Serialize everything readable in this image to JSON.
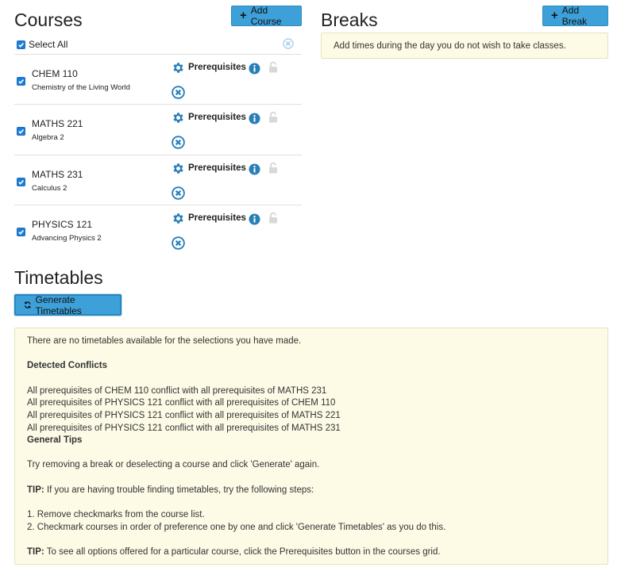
{
  "courses": {
    "title": "Courses",
    "add_label": "Add Course",
    "select_all_label": "Select All",
    "items": [
      {
        "code": "CHEM 110",
        "name": "Chemistry of the Living World",
        "prereq_label": "Prerequisites",
        "checked": true
      },
      {
        "code": "MATHS 221",
        "name": "Algebra 2",
        "prereq_label": "Prerequisites",
        "checked": true
      },
      {
        "code": "MATHS 231",
        "name": "Calculus 2",
        "prereq_label": "Prerequisites",
        "checked": true
      },
      {
        "code": "PHYSICS 121",
        "name": "Advancing Physics 2",
        "prereq_label": "Prerequisites",
        "checked": true
      }
    ]
  },
  "breaks": {
    "title": "Breaks",
    "add_label": "Add Break",
    "empty_message": "Add times during the day you do not wish to take classes."
  },
  "timetables": {
    "title": "Timetables",
    "generate_label": "Generate Timetables",
    "no_timetables": "There are no timetables available for the selections you have made.",
    "conflicts_heading": "Detected Conflicts",
    "conflicts": [
      "All prerequisites of CHEM 110 conflict with all prerequisites of MATHS 231",
      "All prerequisites of PHYSICS 121 conflict with all prerequisites of CHEM 110",
      "All prerequisites of PHYSICS 121 conflict with all prerequisites of MATHS 221",
      "All prerequisites of PHYSICS 121 conflict with all prerequisites of MATHS 231"
    ],
    "tips_heading": "General Tips",
    "tip_generate": "Try removing a break or deselecting a course and click 'Generate' again.",
    "tip_prefix": "TIP:",
    "tip1_text": "If you are having trouble finding timetables, try the following steps:",
    "step1": "1. Remove checkmarks from the course list.",
    "step2": "2. Checkmark courses in order of preference one by one and click 'Generate Timetables' as you do this.",
    "tip2_text": "To see all options offered for a particular course, click the Prerequisites button in the courses grid."
  },
  "icons": {
    "accent": "#3da0d8",
    "icon_blue": "#2a7fb8",
    "box_bg": "#fdfbe6"
  }
}
